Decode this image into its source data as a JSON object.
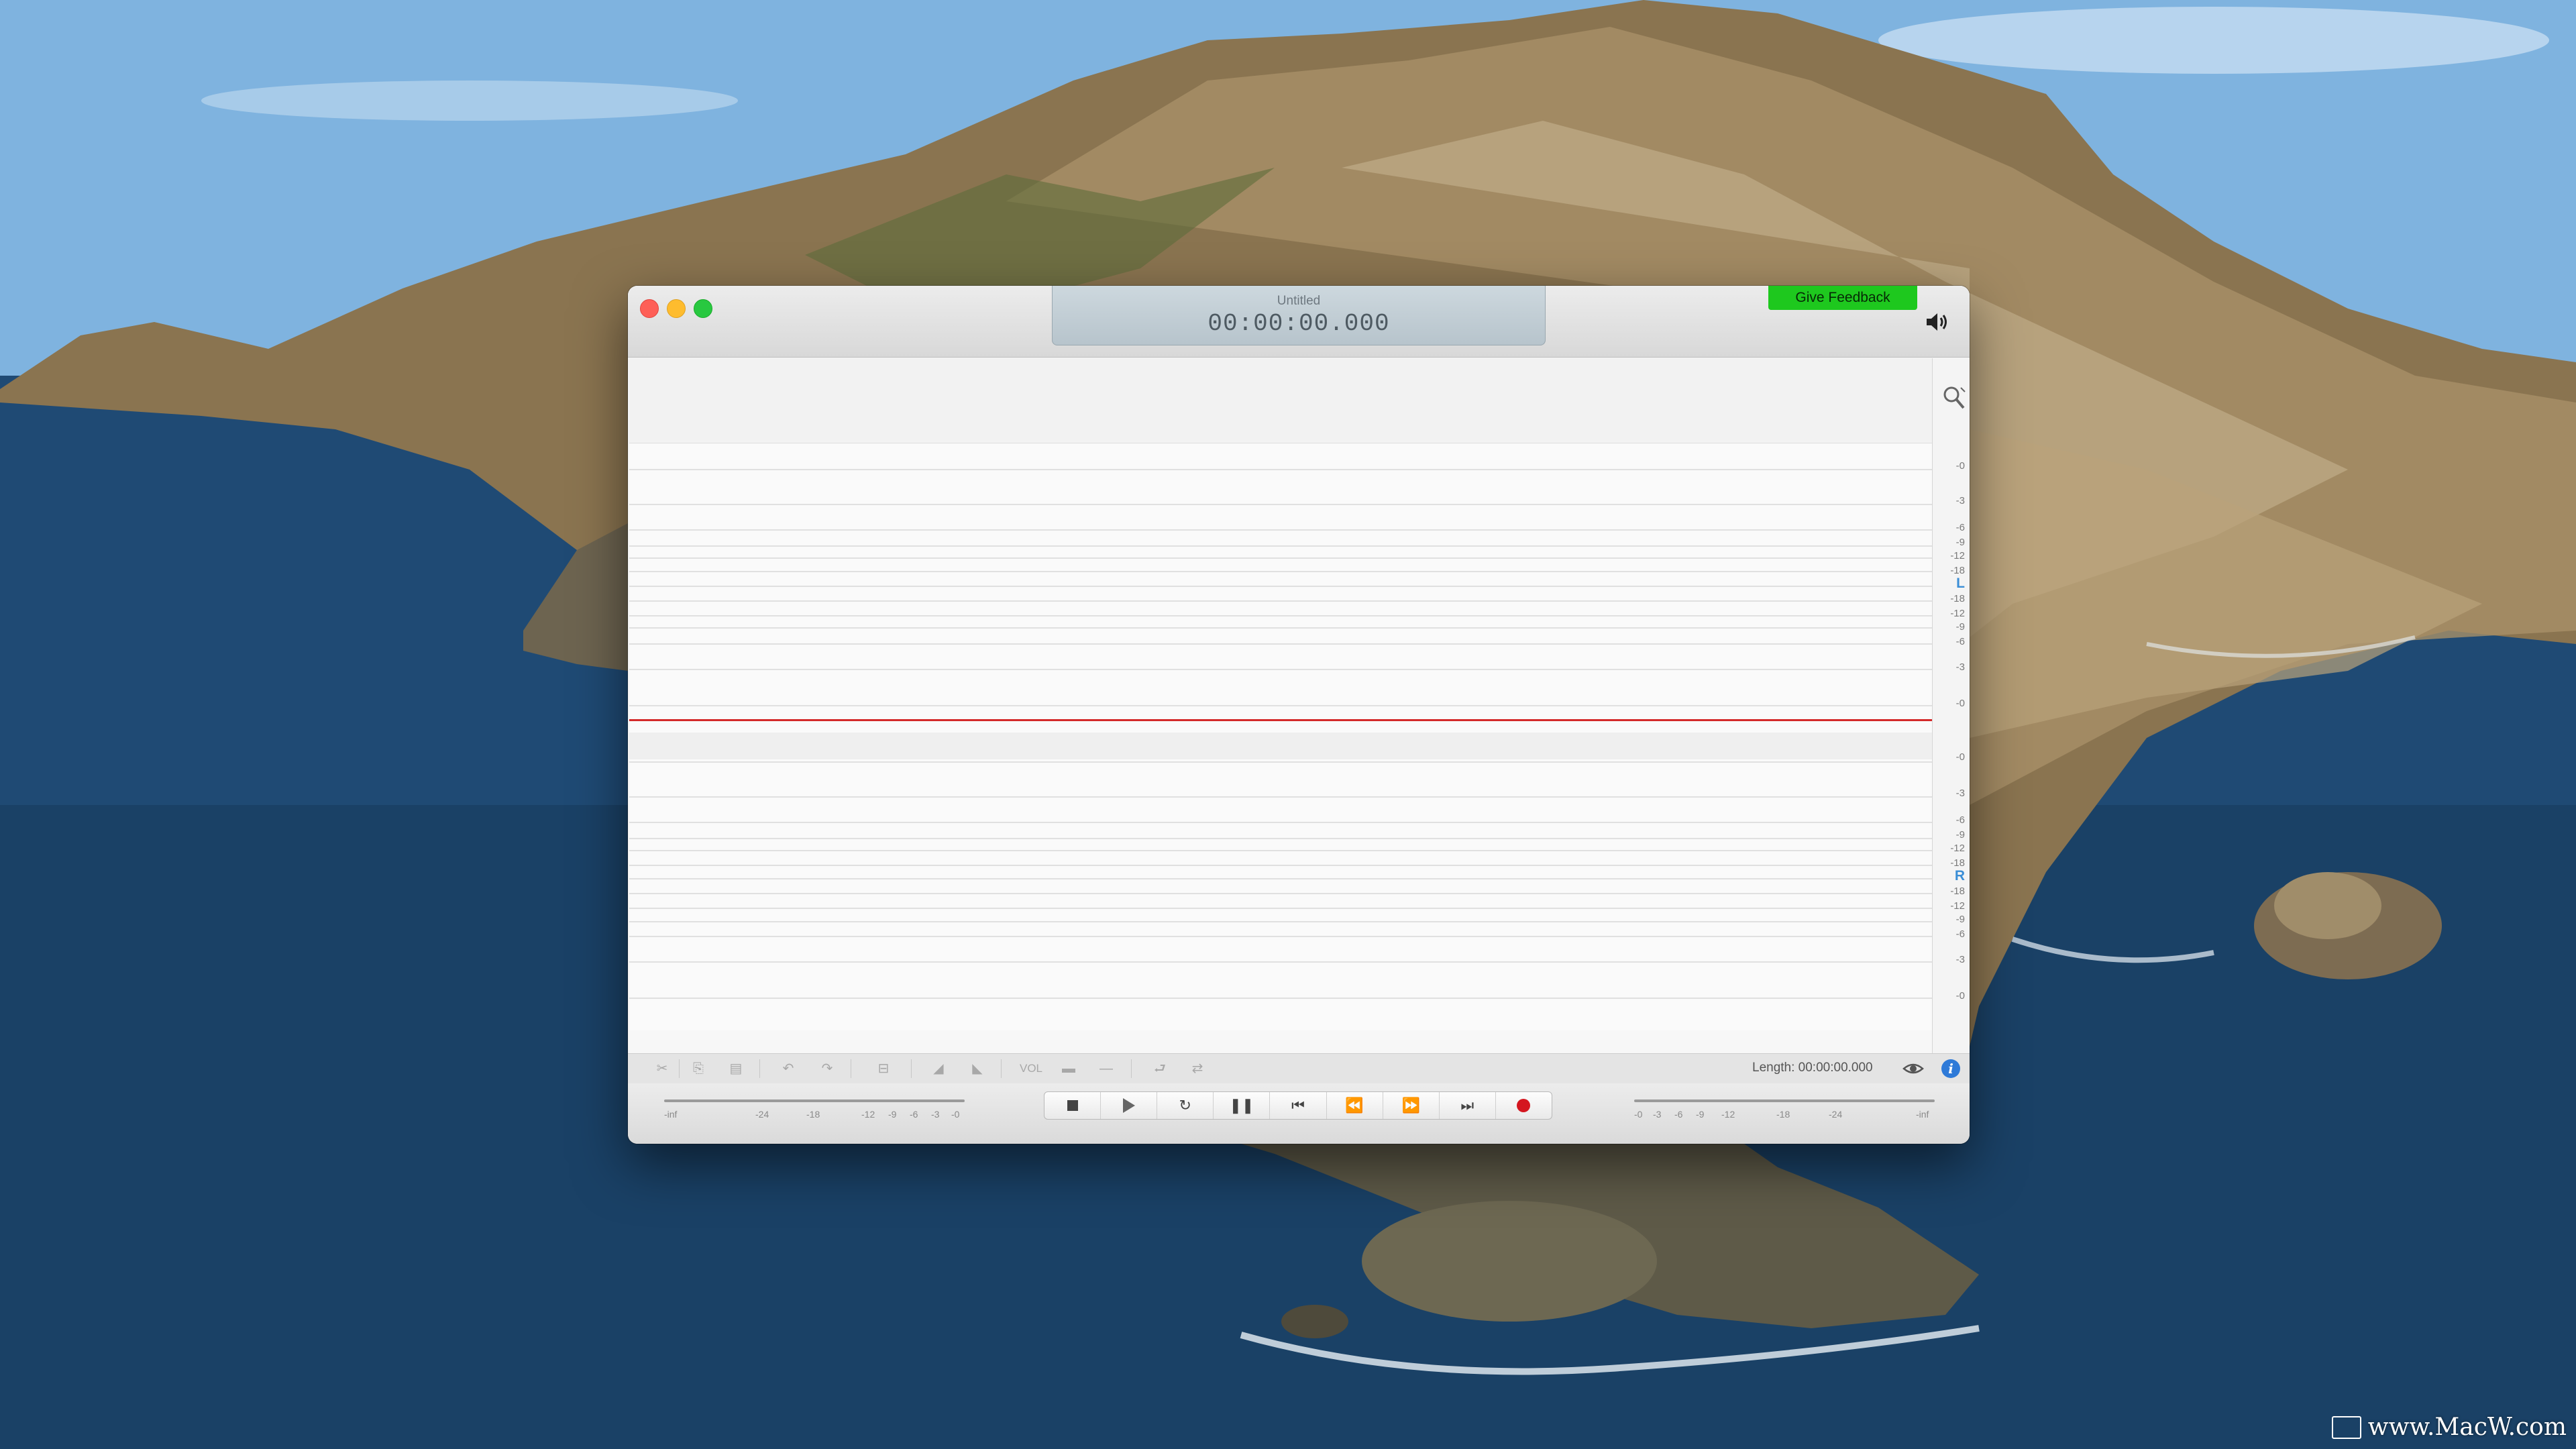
{
  "window": {
    "document_title": "Untitled",
    "time_display": "00:00:00.000",
    "feedback_label": "Give Feedback"
  },
  "ruler": {
    "left_labels": [
      "-0",
      "-3",
      "-6",
      "-9",
      "-12",
      "-18",
      "-18",
      "-12",
      "-9",
      "-6",
      "-3",
      "-0"
    ],
    "right_labels": [
      "-0",
      "-3",
      "-6",
      "-9",
      "-12",
      "-18",
      "-18",
      "-12",
      "-9",
      "-6",
      "-3",
      "-0"
    ],
    "left_channel": "L",
    "right_channel": "R"
  },
  "edit_toolbar": {
    "volume_label": "VOL",
    "length_text": "Length: 00:00:00.000"
  },
  "meters": {
    "input_labels": [
      "-inf",
      "-24",
      "-18",
      "-12",
      "-9",
      "-6",
      "-3",
      "-0"
    ],
    "output_labels": [
      "-0",
      "-3",
      "-6",
      "-9",
      "-12",
      "-18",
      "-24",
      "-inf"
    ]
  },
  "watermark": "www.MacW.com",
  "colors": {
    "feedback_green": "#1ec81e",
    "playhead_red": "#d42a2a",
    "record_red": "#d4161f",
    "channel_blue": "#3b8ed6",
    "info_blue": "#2e7ad8"
  }
}
